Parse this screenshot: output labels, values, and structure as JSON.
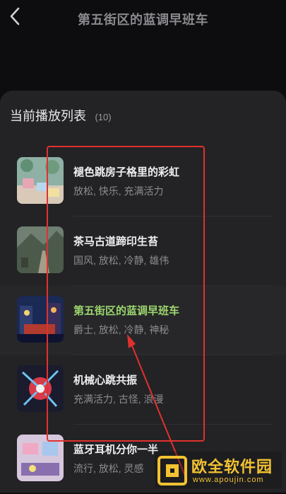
{
  "header": {
    "title": "第五街区的蓝调早班车",
    "back_icon": "chevron-left-icon"
  },
  "playlist": {
    "title": "当前播放列表",
    "count": "(10)",
    "songs": [
      {
        "title": "褪色跳房子格里的彩虹",
        "tags": "放松, 快乐, 充满活力",
        "active": false
      },
      {
        "title": "茶马古道蹄印生苔",
        "tags": "国风, 放松, 冷静, 雄伟",
        "active": false
      },
      {
        "title": "第五街区的蓝调早班车",
        "tags": "爵士, 放松, 冷静, 神秘",
        "active": true
      },
      {
        "title": "机械心跳共振",
        "tags": "充满活力, 古怪, 浪漫",
        "active": false
      },
      {
        "title": "蓝牙耳机分你一半",
        "tags": "流行, 放松, 灵感",
        "active": false
      }
    ]
  },
  "colors": {
    "active": "#9bd66e",
    "annotation": "#e0312e",
    "sheet": "#232326"
  },
  "watermark": {
    "brand": "欧全软件园",
    "url": "www.apoujin.com"
  }
}
